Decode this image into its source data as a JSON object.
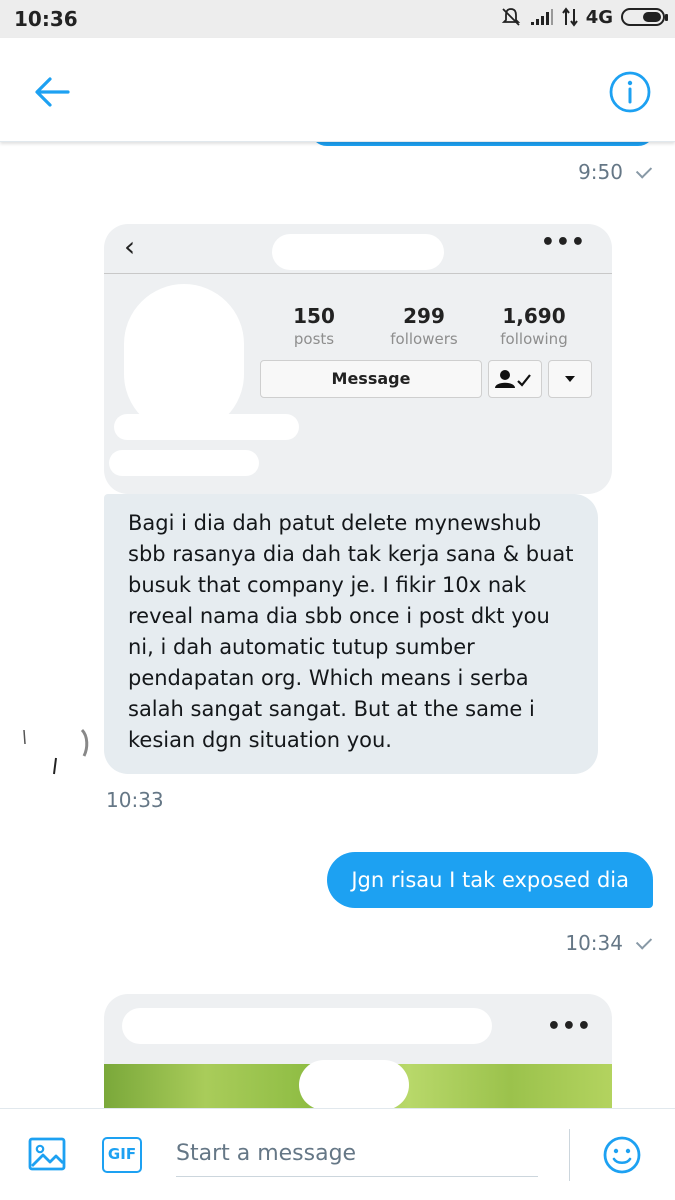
{
  "status_bar": {
    "time": "10:36",
    "network": "4G",
    "icons": [
      "mute-icon",
      "signal-icon",
      "data-arrows-icon",
      "battery-icon"
    ],
    "battery_level": 0.45
  },
  "header": {
    "back_icon": "arrow-left-icon",
    "info_icon": "info-icon",
    "accent_color": "#1da1f2"
  },
  "messages": {
    "first_time": "9:50",
    "card1": {
      "posts_count": "150",
      "posts_label": "posts",
      "followers_count": "299",
      "followers_label": "followers",
      "following_count": "1,690",
      "following_label": "following",
      "message_button": "Message"
    },
    "incoming_text": "Bagi i dia dah patut delete mynewshub sbb rasanya dia dah tak kerja sana & buat busuk that company je. I fikir 10x nak reveal nama dia sbb once i post dkt you ni, i dah automatic tutup sumber pendapatan org. Which means i serba salah sangat sangat. But at the same i kesian dgn situation you.",
    "incoming_time": "10:33",
    "outgoing_text": "Jgn risau I tak exposed dia",
    "outgoing_time": "10:34"
  },
  "composer": {
    "placeholder": "Start a message",
    "gif_label": "GIF"
  }
}
